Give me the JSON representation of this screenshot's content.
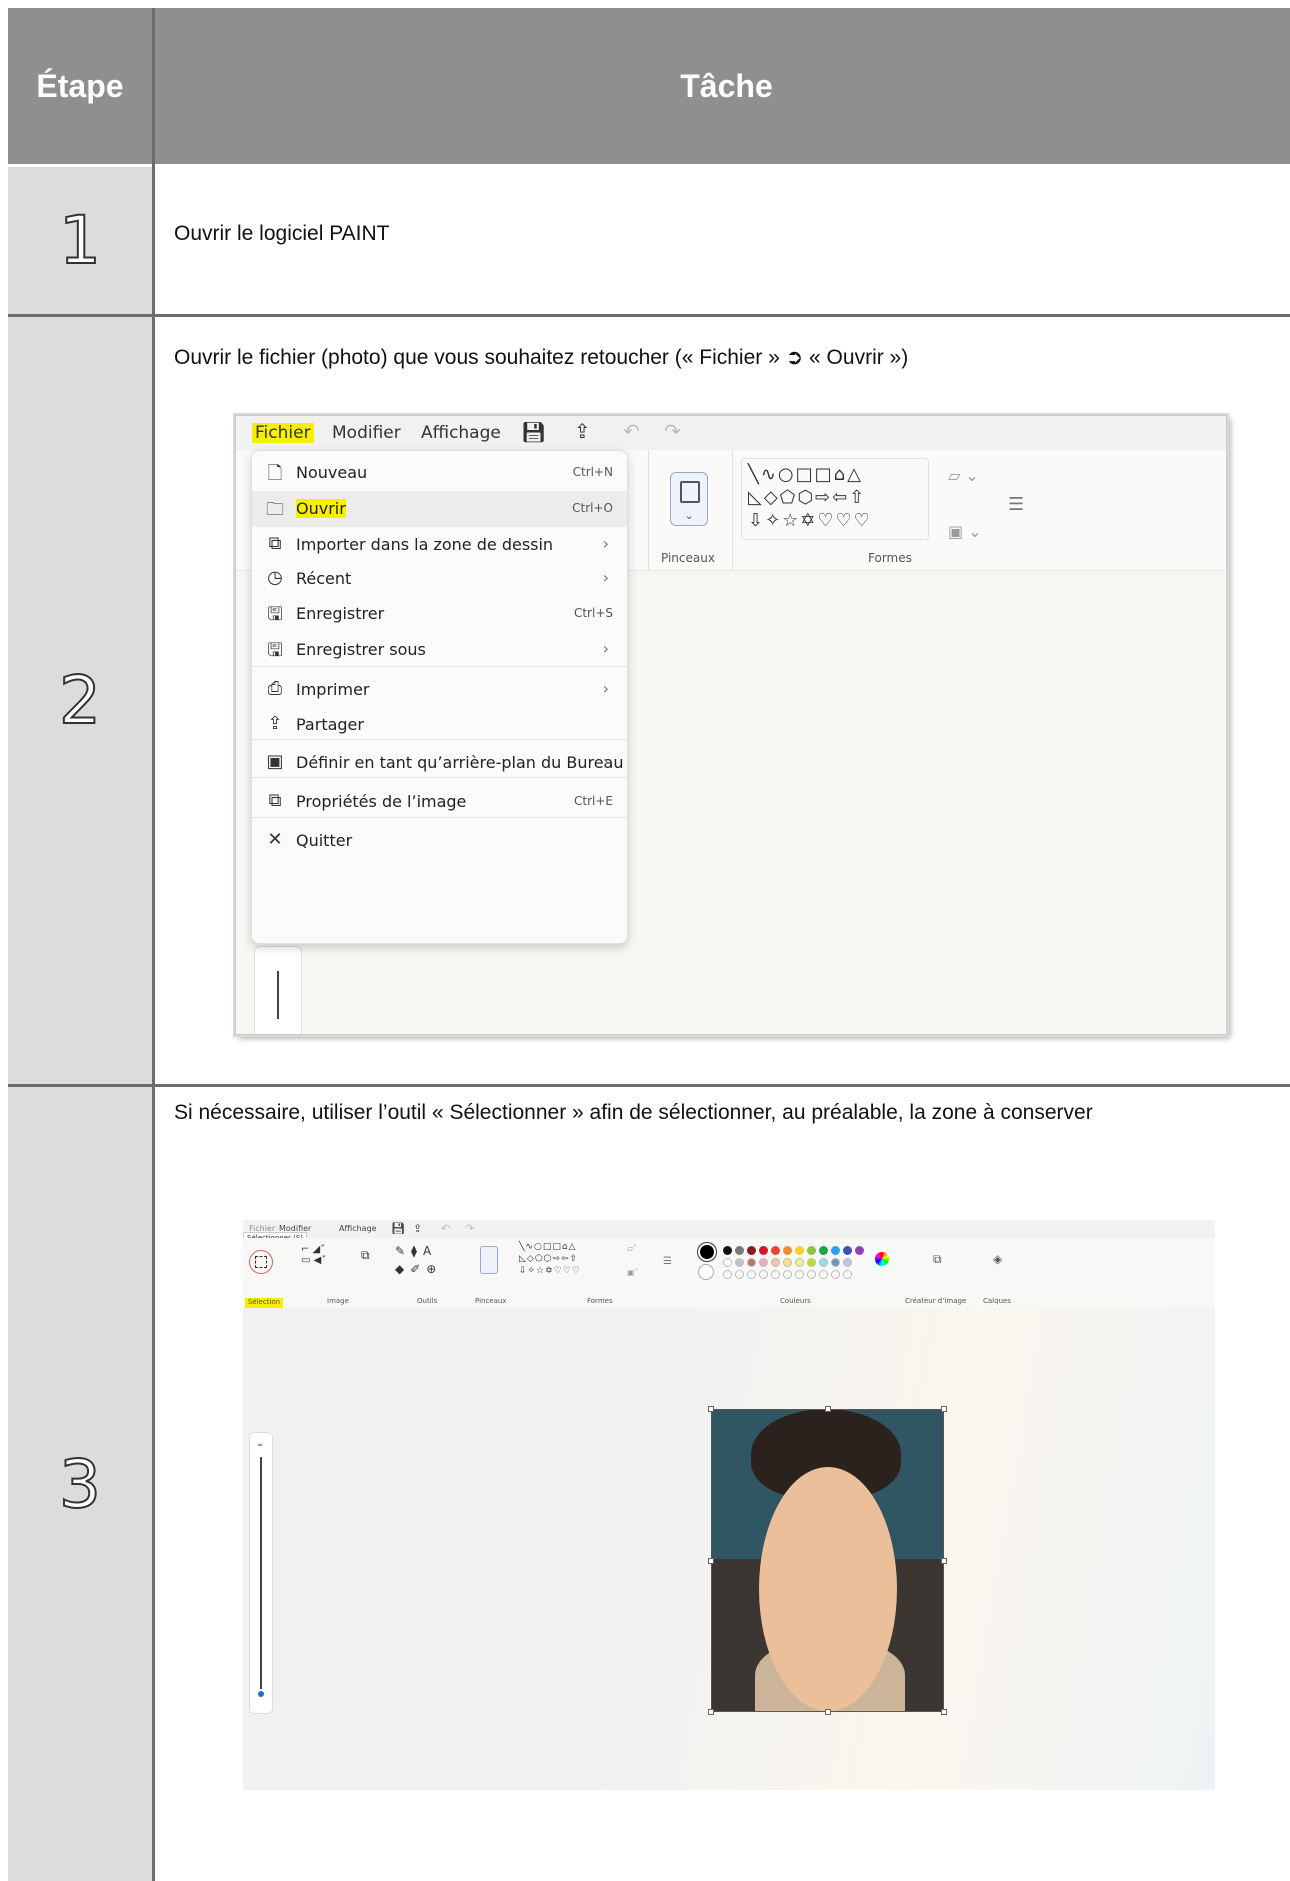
{
  "table": {
    "header": {
      "col_step": "Étape",
      "col_task": "Tâche"
    },
    "rows": [
      {
        "step": "1",
        "task": "Ouvrir le logiciel PAINT"
      },
      {
        "step": "2",
        "task": "Ouvrir le fichier (photo) que vous souhaitez retoucher (« Fichier » ➲ « Ouvrir »)"
      },
      {
        "step": "3",
        "task": "Si nécessaire, utiliser l’outil « Sélectionner » afin de sélectionner, au préalable, la zone à conserver"
      }
    ]
  },
  "screenshot1": {
    "menubar": {
      "fichier": "Fichier",
      "modifier": "Modifier",
      "affichage": "Affichage"
    },
    "ribbon": {
      "pinceaux": "Pinceaux",
      "formes": "Formes"
    },
    "menu_items": [
      {
        "label": "Nouveau",
        "shortcut": "Ctrl+N",
        "icon": "file-icon"
      },
      {
        "label": "Ouvrir",
        "shortcut": "Ctrl+O",
        "icon": "folder-icon"
      },
      {
        "label": "Importer dans la zone de dessin",
        "shortcut": "›",
        "icon": "import-icon"
      },
      {
        "label": "Récent",
        "shortcut": "›",
        "icon": "clock-icon"
      },
      {
        "label": "Enregistrer",
        "shortcut": "Ctrl+S",
        "icon": "save-icon"
      },
      {
        "label": "Enregistrer sous",
        "shortcut": "›",
        "icon": "save-as-icon"
      },
      {
        "label": "Imprimer",
        "shortcut": "›",
        "icon": "printer-icon"
      },
      {
        "label": "Partager",
        "shortcut": "",
        "icon": "share-icon"
      },
      {
        "label": "Définir en tant qu’arrière-plan du Bureau",
        "shortcut": "›",
        "icon": "wallpaper-icon"
      },
      {
        "label": "Propriétés de l’image",
        "shortcut": "Ctrl+E",
        "icon": "properties-icon"
      },
      {
        "label": "Quitter",
        "shortcut": "",
        "icon": "close-icon"
      }
    ]
  },
  "screenshot2": {
    "menubar": {
      "fichier": "Fichier",
      "modifier": "Modifier",
      "affichage": "Affichage"
    },
    "tooltip": "Sélectionner (S)",
    "groups": {
      "selection": "Sélection",
      "image": "Image",
      "outils": "Outils",
      "pinceaux": "Pinceaux",
      "formes": "Formes",
      "couleurs": "Couleurs",
      "createur": "Créateur d’image",
      "calques": "Calques"
    },
    "colors": {
      "row1": [
        "#111111",
        "#7a7a7a",
        "#8b1a1a",
        "#d11a2a",
        "#e8452c",
        "#f28c28",
        "#f7d21c",
        "#8bc53f",
        "#1fa34a",
        "#2a9df4",
        "#3f51b5",
        "#8e44ad"
      ],
      "row2": [
        "#ffffff",
        "#c3c3c3",
        "#b97a57",
        "#f5a9b8",
        "#f7c6a0",
        "#ffe27a",
        "#eef58d",
        "#b5e61d",
        "#99d9ea",
        "#7092be",
        "#c8bfe7"
      ]
    }
  }
}
